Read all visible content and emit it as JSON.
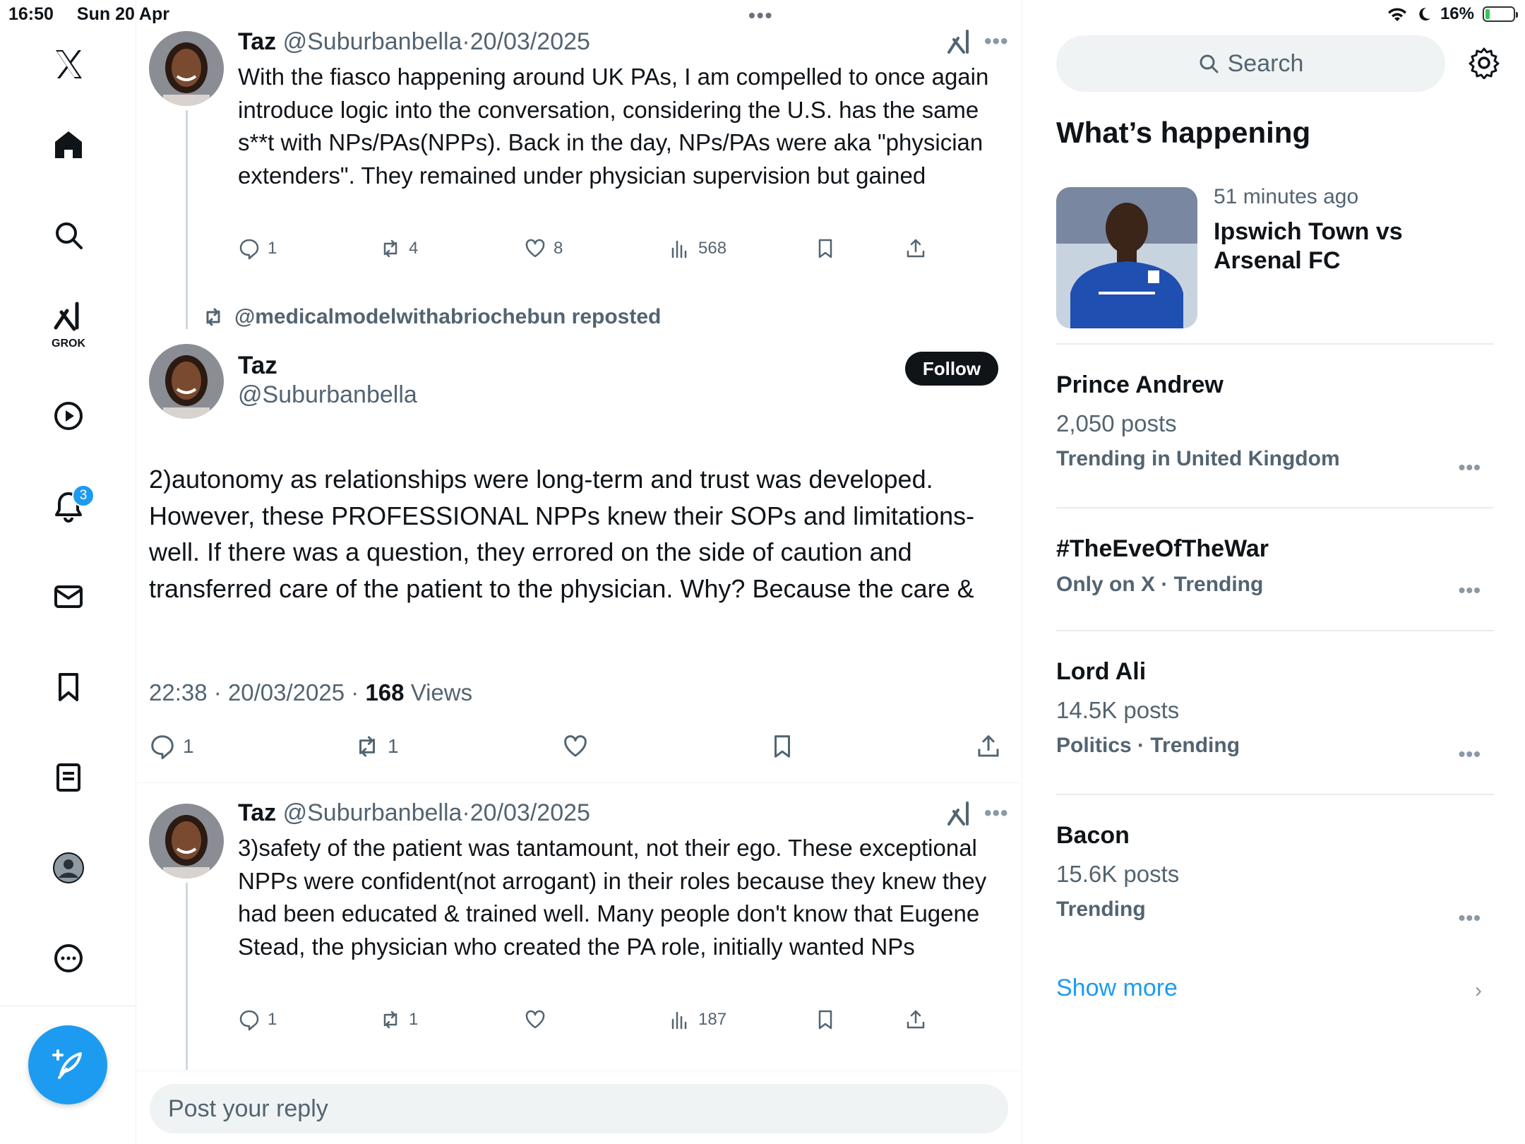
{
  "status_bar": {
    "time": "16:50",
    "date": "Sun 20 Apr",
    "battery": "16%",
    "battery_level": 0.16
  },
  "nav": {
    "grok_label": "GROK",
    "notifications_badge": "3"
  },
  "tweets": [
    {
      "name": "Taz",
      "handle": "@Suburbanbella",
      "date_sep": "·",
      "date": "20/03/2025",
      "text": "With the fiasco happening around UK PAs, I am compelled to once again introduce logic into the conversation, considering the U.S. has the same s**t with NPs/PAs(NPPs). Back in the day, NPs/PAs were aka \"physician extenders\". They remained under physician supervision but gained",
      "replies": "1",
      "reposts": "4",
      "likes": "8",
      "views": "568"
    },
    {
      "name": "Taz",
      "handle": "@Suburbanbella",
      "date_sep": "·",
      "date": "20/03/2025",
      "text": "3)safety of the patient was tantamount, not their ego. These exceptional NPPs were confident(not arrogant) in their roles because they knew they had been educated & trained well. Many people don't know that Eugene Stead, the physician who created the PA role, initially wanted NPs",
      "replies": "1",
      "reposts": "1",
      "likes": "",
      "views": "187"
    }
  ],
  "focus_tweet": {
    "repost_label": "@medicalmodelwithabriochebun reposted",
    "name": "Taz",
    "handle": "@Suburbanbella",
    "follow_label": "Follow",
    "text": "2)autonomy as relationships were long-term and trust was developed. However, these PROFESSIONAL NPPs knew their SOPs and limitations-well. If there was a question, they errored on the side of caution and transferred care of the patient to the physician. Why? Because the care &",
    "time": "22:38",
    "date": "20/03/2025",
    "sep": "·",
    "views_count": "168",
    "views_label": "Views",
    "replies": "1",
    "reposts": "1"
  },
  "reply_placeholder": "Post your reply",
  "sidebar": {
    "search_placeholder": "Search",
    "title": "What’s happening",
    "featured": {
      "time": "51 minutes ago",
      "headline": "Ipswich Town vs Arsenal FC"
    },
    "trends": [
      {
        "name": "Prince Andrew",
        "posts": "2,050 posts",
        "context": "Trending in United Kingdom"
      },
      {
        "name": "#TheEveOfTheWar",
        "posts": "",
        "context": "Only on X · Trending"
      },
      {
        "name": "Lord Ali",
        "posts": "14.5K posts",
        "context": "Politics · Trending"
      },
      {
        "name": "Bacon",
        "posts": "15.6K posts",
        "context": "Trending"
      }
    ],
    "show_more": "Show more"
  },
  "colors": {
    "accent": "#1d9bf0",
    "text": "#0f1419",
    "muted": "#536471",
    "divider": "#eff3f4"
  },
  "icons": [
    "x-logo-icon",
    "home-icon",
    "search-icon",
    "grok-icon",
    "video-icon",
    "bell-icon",
    "mail-icon",
    "bookmark-icon",
    "list-icon",
    "profile-icon",
    "more-icon",
    "compose-icon",
    "reply-icon",
    "repost-icon",
    "like-icon",
    "views-icon",
    "share-icon",
    "settings-icon",
    "chevron-right-icon"
  ]
}
